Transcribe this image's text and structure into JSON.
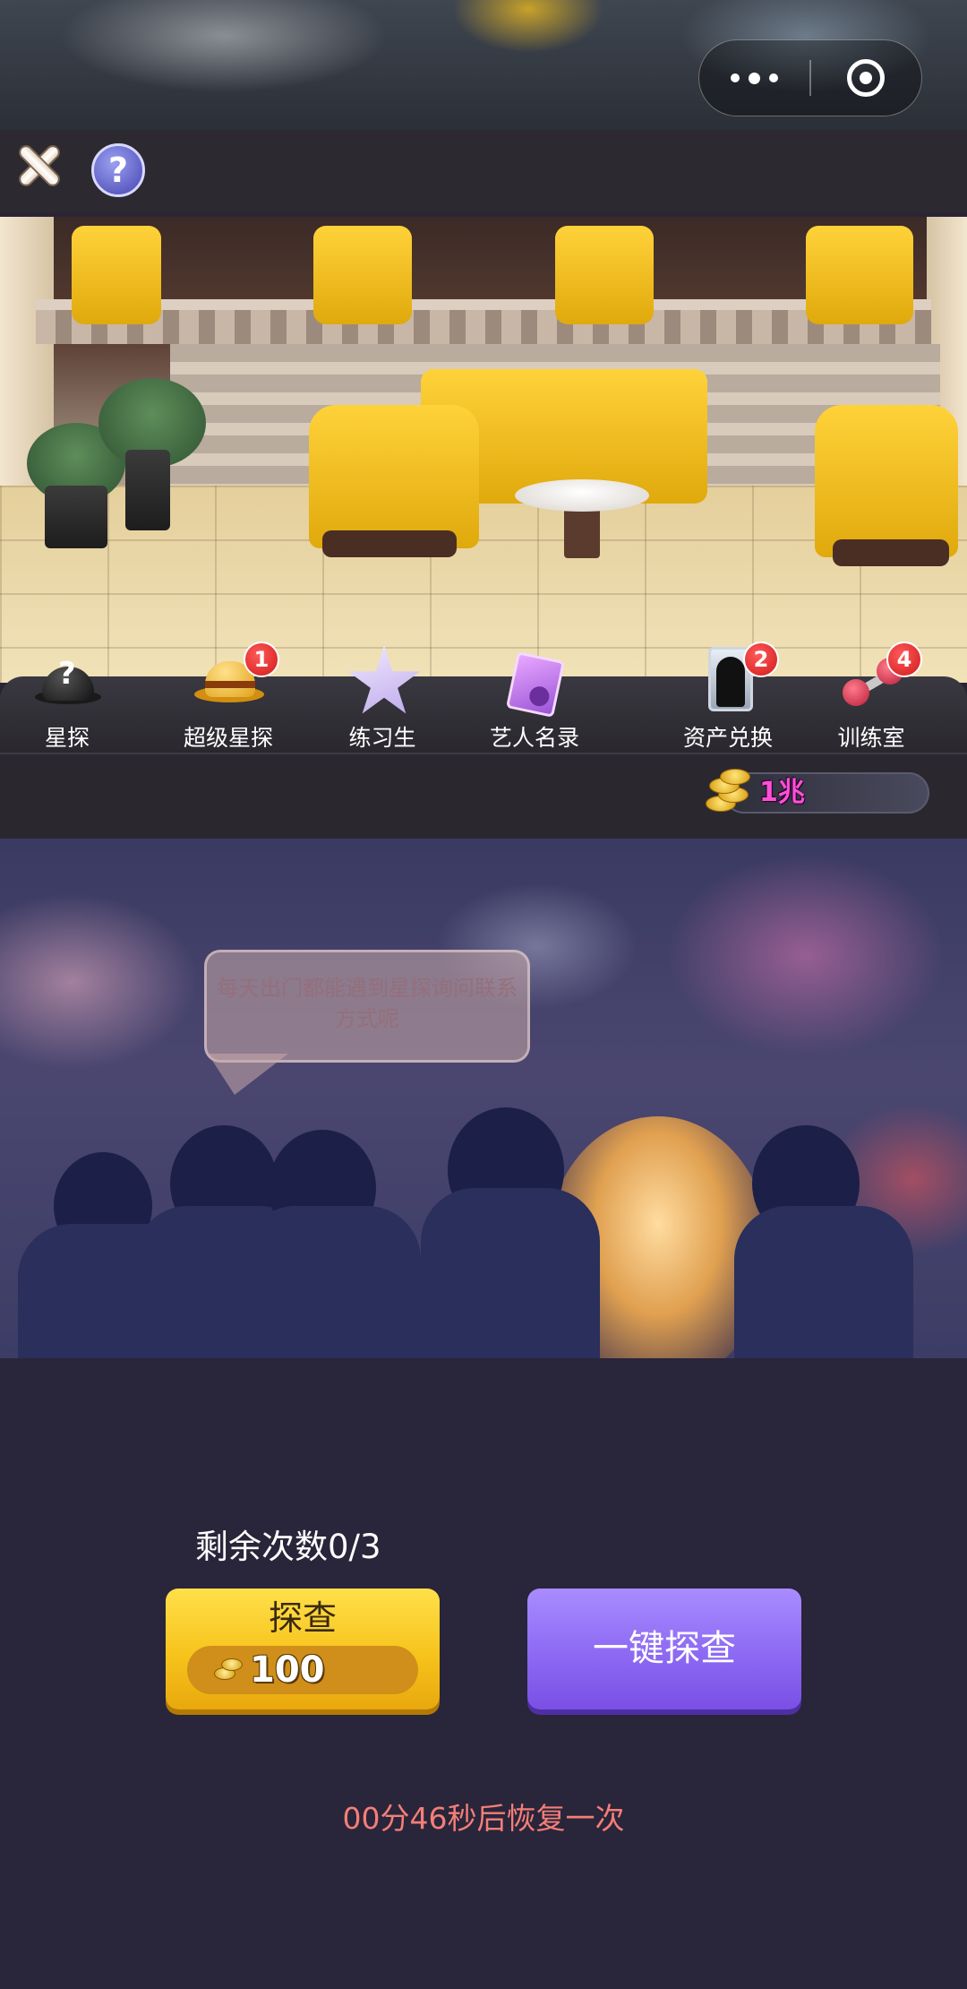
{
  "capsule": {
    "more_icon": "more-dots-icon",
    "close_icon": "target-circle-icon"
  },
  "toolbar": {
    "close_icon": "close-x-icon",
    "help_label": "?"
  },
  "menu": {
    "items": [
      {
        "label": "星探",
        "icon": "black-hat-question-icon",
        "badge": ""
      },
      {
        "label": "超级星探",
        "icon": "gold-hat-icon",
        "badge": "1"
      },
      {
        "label": "练习生",
        "icon": "star-trainee-icon",
        "badge": ""
      },
      {
        "label": "艺人名录",
        "icon": "artist-book-icon",
        "badge": ""
      },
      {
        "label": "资产兑换",
        "icon": "silhouette-card-icon",
        "badge": "2"
      },
      {
        "label": "训练室",
        "icon": "dumbbell-icon",
        "badge": "4"
      }
    ]
  },
  "currency": {
    "amount": "1兆",
    "icon": "gold-coin-stack-icon"
  },
  "street": {
    "bubble_text": "每天出门都能遇到星探询问联系方式呢"
  },
  "probe": {
    "remaining": "剩余次数0/3",
    "button_label": "探查",
    "cost": "100",
    "one_click_label": "一键探查",
    "timer": "00分46秒后恢复一次"
  },
  "colors": {
    "accent_gold": "#f7c31c",
    "accent_purple": "#8a66f2",
    "timer_red": "#f47e78",
    "coin_pink": "#ff4fd8"
  }
}
